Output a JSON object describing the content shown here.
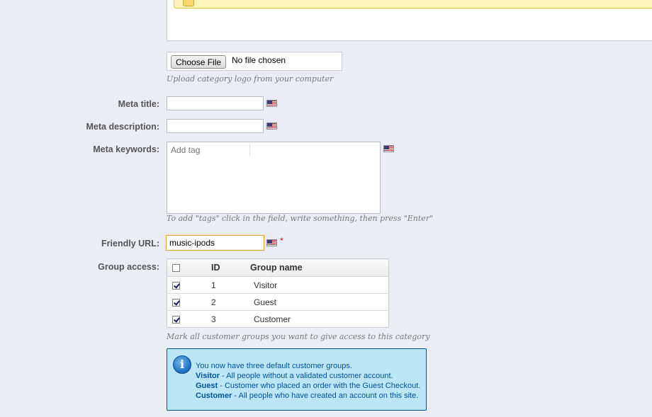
{
  "logo_upload": {
    "button_label": "Choose File",
    "status": "No file chosen",
    "hint": "Upload category logo from your computer"
  },
  "meta_title": {
    "label": "Meta title:",
    "value": ""
  },
  "meta_description": {
    "label": "Meta description:",
    "value": ""
  },
  "meta_keywords": {
    "label": "Meta keywords:",
    "placeholder": "Add tag",
    "hint": "To add \"tags\" click in the field, write something, then press \"Enter\""
  },
  "friendly_url": {
    "label": "Friendly URL:",
    "value": "music-ipods",
    "required_mark": "*"
  },
  "group_access": {
    "label": "Group access:",
    "columns": [
      "ID",
      "Group name"
    ],
    "rows": [
      {
        "id": "1",
        "name": "Visitor",
        "checked": true
      },
      {
        "id": "2",
        "name": "Guest",
        "checked": true
      },
      {
        "id": "3",
        "name": "Customer",
        "checked": true
      }
    ],
    "hint": "Mark all customer groups you want to give access to this category"
  },
  "info": {
    "intro": "You now have three default customer groups.",
    "items": [
      {
        "name": "Visitor",
        "text": " - All people without a validated customer account."
      },
      {
        "name": "Guest",
        "text": " - Customer who placed an order with the Guest Checkout."
      },
      {
        "name": "Customer",
        "text": " - All people who have created an account on this site."
      }
    ]
  },
  "icons": {
    "language_flag": "us-flag-icon",
    "info": "info-icon"
  },
  "colors": {
    "background": "#eaedf4",
    "info_bg": "#bde5f8",
    "info_text": "#00529b",
    "focus_border": "#e5a33b"
  }
}
